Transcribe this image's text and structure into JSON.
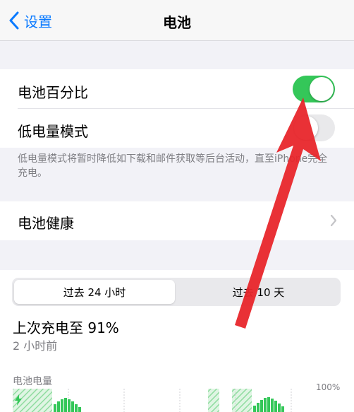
{
  "nav": {
    "back_label": "设置",
    "title": "电池"
  },
  "settings": {
    "battery_percentage_label": "电池百分比",
    "battery_percentage_on": true,
    "low_power_label": "低电量模式",
    "low_power_on": false,
    "low_power_footnote": "低电量模式将暂时降低如下载和邮件获取等后台活动，直至iPhone完全充电。",
    "battery_health_label": "电池健康"
  },
  "usage": {
    "tabs": [
      {
        "label": "过去 24 小时",
        "selected": true
      },
      {
        "label": "过去 10 天",
        "selected": false
      }
    ],
    "last_charge": "上次充电至 91%",
    "last_charge_ago": "2 小时前",
    "chart_title": "电池电量",
    "axis_label_partial": "100%"
  },
  "colors": {
    "accent": "#0a7aff",
    "toggle_on": "#34c759",
    "annotation_arrow": "#e8262b"
  }
}
